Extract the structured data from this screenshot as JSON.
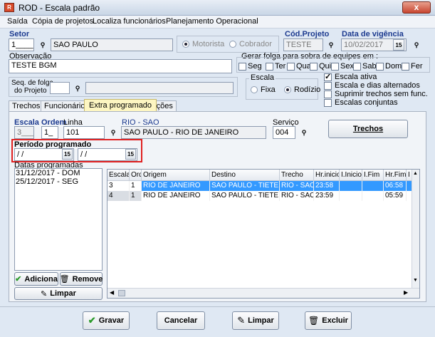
{
  "window": {
    "title": "ROD - Escala padrão",
    "close": "x"
  },
  "menu": [
    "Saída",
    "Cópia de projetos",
    "Localiza funcionários",
    "Planejamento Operacional"
  ],
  "setor": {
    "label": "Setor",
    "code": "1____",
    "name": "SAO PAULO"
  },
  "role": {
    "motorista": "Motorista",
    "cobrador": "Cobrador"
  },
  "projeto": {
    "label": "Cód.Projeto",
    "value": "TESTE"
  },
  "vigencia": {
    "label": "Data de vigência",
    "value": "10/02/2017"
  },
  "observacao": {
    "label": "Observação",
    "value": "TESTE BGM"
  },
  "folga": {
    "title": "Gerar folga para sobra de equipes em :",
    "days": [
      "Seg",
      "Ter",
      "Qua",
      "Qui",
      "Sex",
      "Sab",
      "Dom",
      "Fer"
    ]
  },
  "seq": {
    "label1": "Seq. de folga",
    "label2": "do Projeto",
    "value": ""
  },
  "escala_group": {
    "label": "Escala",
    "fixa": "Fixa",
    "rodizio": "Rodízio"
  },
  "options": {
    "ativa": "Escala ativa",
    "alternados": "Escala e dias alternados",
    "suprimir": "Suprimir trechos sem func.",
    "conjuntas": "Escalas conjuntas"
  },
  "tabs": [
    "Trechos",
    "Funcionários",
    "Extra programado",
    "Opções"
  ],
  "form": {
    "escala_label": "Escala",
    "escala_value": "3___",
    "ordem_label": "Ordem",
    "ordem_value": "1_",
    "linha_label": "Linha",
    "linha_value": "101",
    "linha_title": "RIO - SAO",
    "linha_name": "SAO PAULO - RIO DE JANEIRO",
    "servico_label": "Serviço",
    "servico_value": "004",
    "trechos_btn": "Trechos"
  },
  "periodo": {
    "label": "Período programado",
    "start": " / /",
    "end": " / /"
  },
  "datas": {
    "label": "Datas programadas",
    "items": [
      "31/12/2017 - DOM",
      "25/12/2017 - SEG"
    ]
  },
  "grid": {
    "headers": [
      "Escala",
      "Ord",
      "Origem",
      "Destino",
      "Trecho",
      "Hr.inicio",
      "I.Inicio",
      "I.Fim",
      "Hr.Fim",
      "I"
    ],
    "rows": [
      [
        "3",
        "1",
        "RIO DE JANEIRO",
        "SAO PAULO - TIETE",
        "RIO - SAO",
        "23:58",
        "",
        "",
        "06:58",
        ""
      ],
      [
        "4",
        "1",
        "RIO DE JANEIRO",
        "SAO PAULO - TIETE",
        "RIO - SAO",
        "23:59",
        "",
        "",
        "05:59",
        ""
      ]
    ]
  },
  "list_buttons": {
    "adicionar": "Adiciona",
    "remover": "Remove",
    "limpar": "Limpar"
  },
  "footer": {
    "gravar": "Gravar",
    "cancelar": "Cancelar",
    "limpar": "Limpar",
    "excluir": "Excluir"
  }
}
